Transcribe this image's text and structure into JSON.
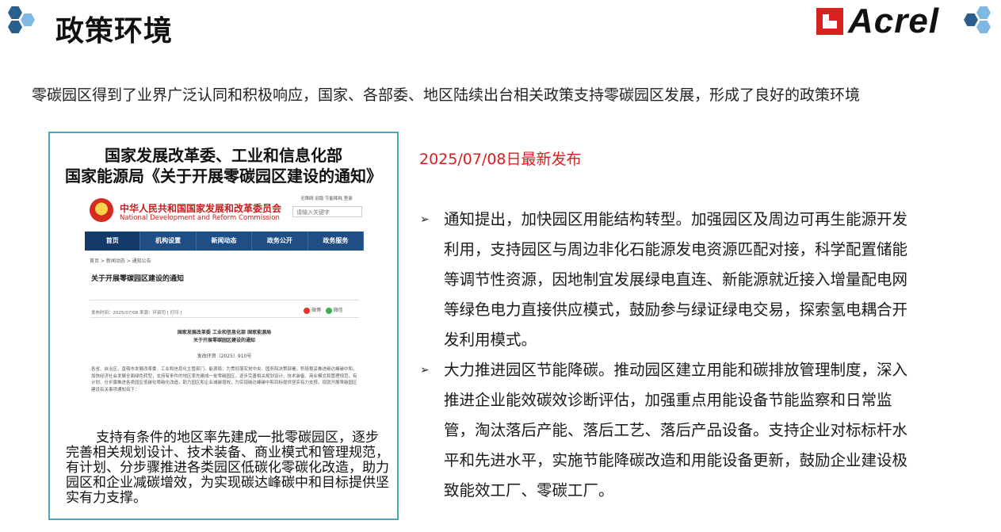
{
  "header": {
    "title": "政策环境",
    "brand": "Acrel",
    "colors": {
      "hex_dark": "#2a5e8c",
      "hex_light": "#7fb8e0",
      "logo_red": "#d7231f"
    }
  },
  "intro": "零碳园区得到了业界广泛认同和积极响应，国家、各部委、地区陆续出台相关政策支持零碳园区发展，形成了良好的政策环境",
  "panel": {
    "title_line1": "国家发展改革委、工业和信息化部",
    "title_line2": "国家能源局《关于开展零碳园区建设的通知》",
    "screenshot": {
      "org_cn": "中华人民共和国国家发展和改革委员会",
      "org_en": "National Development and Reform Commission",
      "top_links": "无障碍  旧版  节能降耗  登录",
      "search_placeholder": "请输入关键字",
      "nav": [
        "首页",
        "机构设置",
        "新闻动态",
        "政务公开",
        "政务服务"
      ],
      "breadcrumb": "首页 > 新闻动态 > 通知公告",
      "article_title": "关于开展零碳园区建设的通知",
      "meta": "发布时间：2025/07/08      来源：环资司      [ 打印 ]",
      "share_weibo": "微博",
      "share_wechat": "微信",
      "doc_head1": "国家发展改革委 工业和信息化部 国家能源局",
      "doc_head2": "关于开展零碳园区建设的通知",
      "doc_number": "发改环资〔2025〕910号",
      "doc_body": "各省、自治区、直辖市发展改革委、工业和信息化主管部门、能源局：为贯彻落实党中央、国务院决策部署，积极稳妥推进碳达峰碳中和，加快经济社会发展全面绿色转型，支持有条件的地区率先建成一批零碳园区，逐步完善相关规划设计、技术装备、商业模式和管理规范，有计划、分步骤推进各类园区低碳化零碳化改造，助力园区和企业减碳增效，为实现碳达峰碳中和目标提供坚实有力支撑。现就开展零碳园区建设有关事项通知如下："
    },
    "quote": "支持有条件的地区率先建成一批零碳园区，逐步完善相关规划设计、技术装备、商业模式和管理规范，有计划、分步骤推进各类园区低碳化零碳化改造，助力园区和企业减碳增效，为实现碳达峰碳中和目标提供坚实有力支撑。"
  },
  "right": {
    "date_note": "2025/07/08日最新发布",
    "bullets": [
      "通知提出，加快园区用能结构转型。加强园区及周边可再生能源开发利用，支持园区与周边非化石能源发电资源匹配对接，科学配置储能等调节性资源，因地制宜发展绿电直连、新能源就近接入增量配电网等绿色电力直接供应模式，鼓励参与绿证绿电交易，探索氢电耦合开发利用模式。",
      "大力推进园区节能降碳。推动园区建立用能和碳排放管理制度，深入推进企业能效碳效诊断评估，加强重点用能设备节能监察和日常监管，淘汰落后产能、落后工艺、落后产品设备。支持企业对标标杆水平和先进水平，实施节能降碳改造和用能设备更新，鼓励企业建设极致能效工厂、零碳工厂。"
    ]
  }
}
